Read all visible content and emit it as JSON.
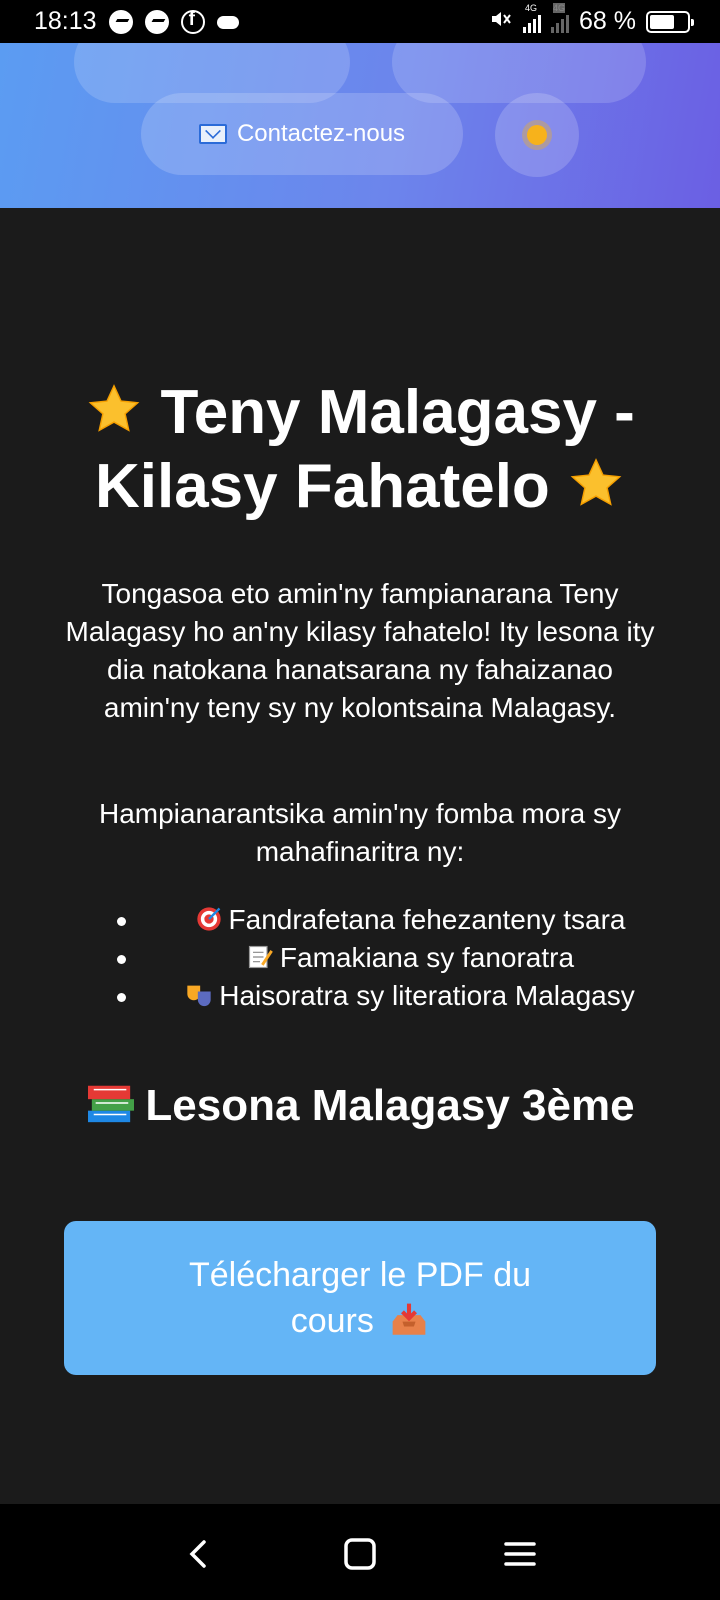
{
  "status_bar": {
    "time": "18:13",
    "network_type_1": "4G",
    "network_type_2": "4G",
    "battery": "68 %",
    "battery_level": 0.68
  },
  "header": {
    "contact_label": "Contactez-nous",
    "contact_icon": "email-icon",
    "theme_icon": "sun-icon"
  },
  "main": {
    "title": "Teny Malagasy - Kilasy Fahatelo",
    "intro": "Tongasoa eto amin'ny fampianarana Teny Malagasy ho an'ny kilasy fahatelo! Ity lesona ity dia natokana hanatsarana ny fahaizanao amin'ny teny sy ny kolontsaina Malagasy.",
    "intro2": "Hampianarantsika amin'ny fomba mora sy mahafinaritra ny:",
    "features": [
      {
        "icon": "target-icon",
        "label": "Fandrafetana fehezanteny tsara"
      },
      {
        "icon": "memo-icon",
        "label": "Famakiana sy fanoratra"
      },
      {
        "icon": "theater-masks-icon",
        "label": "Haisoratra sy literatiora Malagasy"
      }
    ],
    "subtitle": "Lesona Malagasy 3ème",
    "download_label": "Télécharger le PDF du cours"
  },
  "colors": {
    "header_gradient_start": "#5b9cf2",
    "header_gradient_end": "#6b5fe3",
    "background": "#1b1b1b",
    "download_button": "#64b5f6"
  }
}
